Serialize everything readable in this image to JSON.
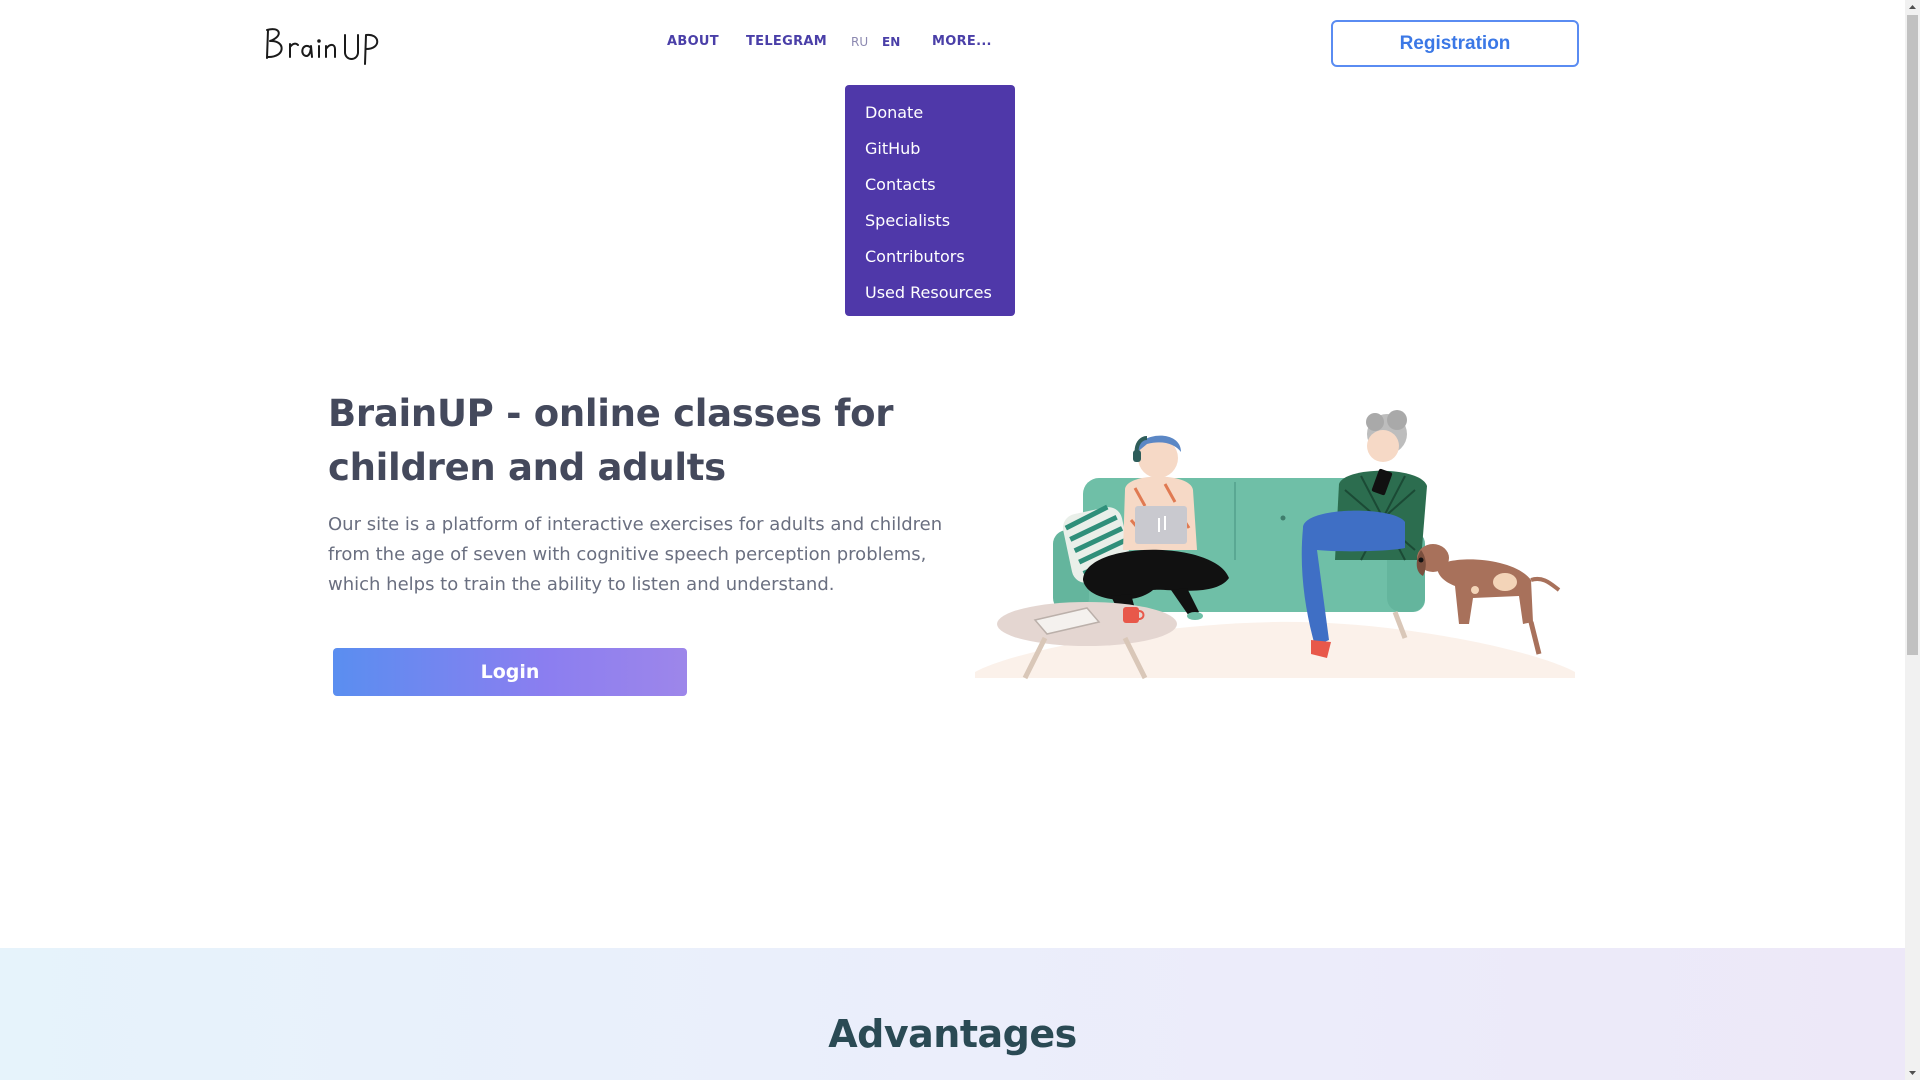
{
  "header": {
    "logo_text": "BrainUP",
    "nav": {
      "about": "ABOUT",
      "telegram": "TELEGRAM",
      "lang_ru": "RU",
      "lang_en": "EN",
      "more": "MORE..."
    },
    "registration_label": "Registration"
  },
  "more_menu": {
    "items": [
      {
        "label": "Donate"
      },
      {
        "label": "GitHub"
      },
      {
        "label": "Contacts"
      },
      {
        "label": "Specialists"
      },
      {
        "label": "Contributors"
      },
      {
        "label": "Used Resources"
      }
    ]
  },
  "hero": {
    "title": "BrainUP - online classes for children and adults",
    "description": "Our site is a platform of interactive exercises for adults and children from the age of seven with cognitive speech perception problems, which helps to train the ability to listen and understand.",
    "login_label": "Login"
  },
  "advantages": {
    "title": "Advantages"
  },
  "colors": {
    "brand_purple": "#4f38a9",
    "nav_text": "#4a3fa8",
    "registration_blue": "#3b78e6",
    "login_gradient_start": "#5a8ef0",
    "login_gradient_end": "#9d86ea",
    "sofa_green": "#6fbfa7"
  },
  "icons": {
    "logo": "brainup-handwritten-logo",
    "illustration": "family-on-sofa-illustration",
    "scroll_up": "scroll-up-arrow-icon",
    "scroll_down": "scroll-down-arrow-icon"
  }
}
